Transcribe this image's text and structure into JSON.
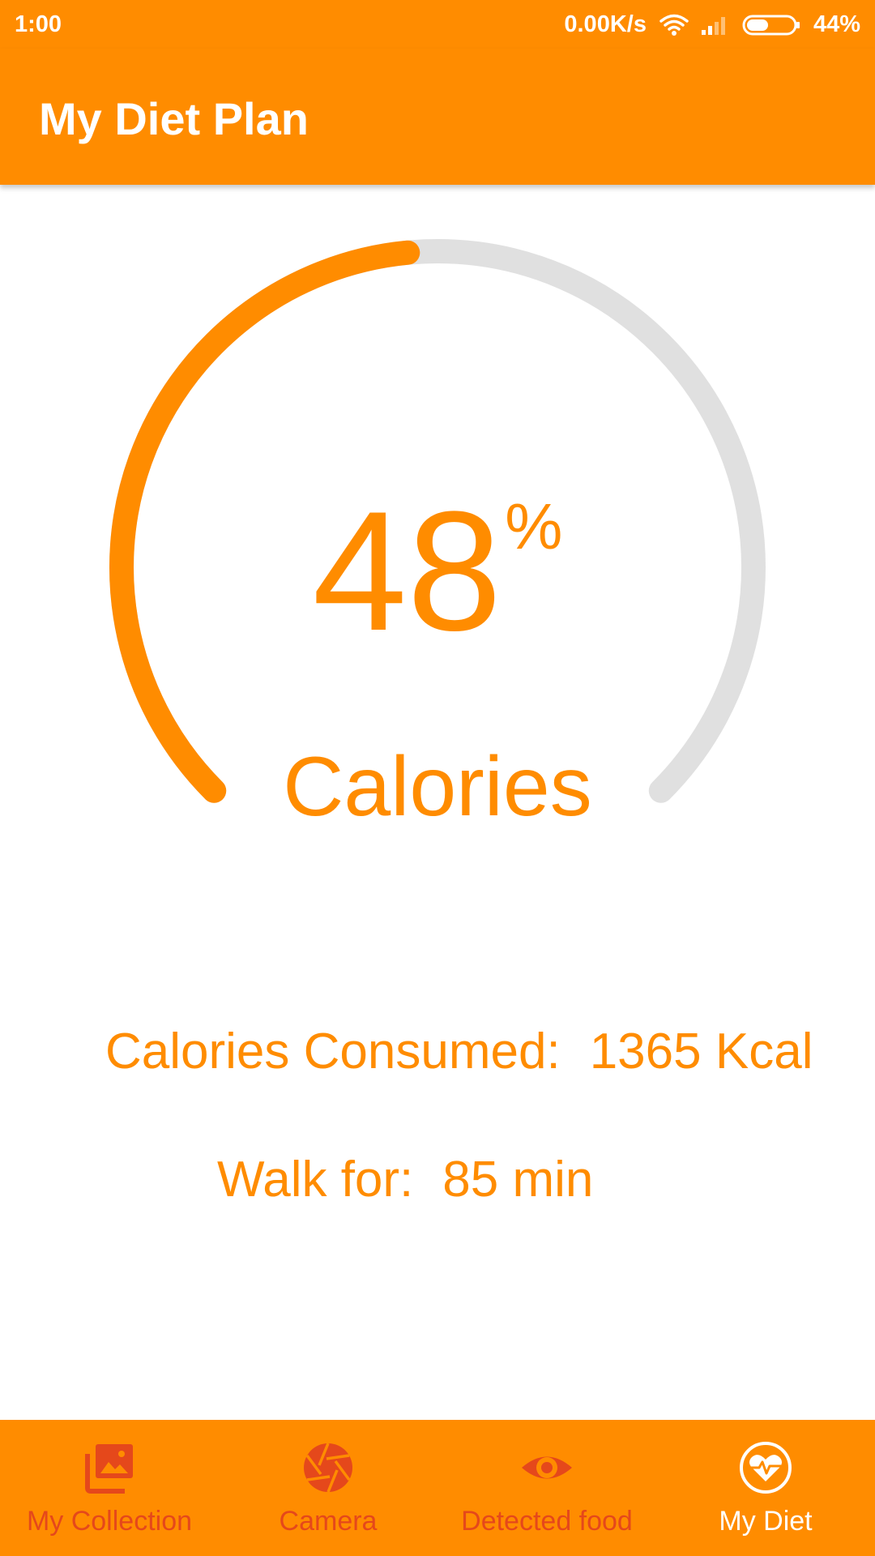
{
  "status_bar": {
    "time": "1:00",
    "network_speed": "0.00K/s",
    "battery": "44%",
    "icons": [
      "wifi-icon",
      "signal-icon",
      "battery-icon"
    ]
  },
  "app_bar": {
    "title": "My Diet Plan"
  },
  "gauge": {
    "percent": 48,
    "value": "48",
    "unit": "%",
    "label": "Calories",
    "progress_color": "#FF8C00",
    "track_color": "#E0E0E0"
  },
  "stats": {
    "calories_label": "Calories Consumed:",
    "calories_value": "1365 Kcal",
    "walk_label": "Walk for:",
    "walk_value": "85 min"
  },
  "bottom_nav": {
    "items": [
      {
        "label": "My Collection",
        "icon": "gallery-icon",
        "active": false
      },
      {
        "label": "Camera",
        "icon": "aperture-icon",
        "active": false
      },
      {
        "label": "Detected food",
        "icon": "eye-icon",
        "active": false
      },
      {
        "label": "My Diet",
        "icon": "heart-pulse-icon",
        "active": true
      }
    ]
  },
  "colors": {
    "primary": "#FF8C00",
    "inactive_nav": "#E5481B",
    "active_nav": "#FFFFFF"
  }
}
